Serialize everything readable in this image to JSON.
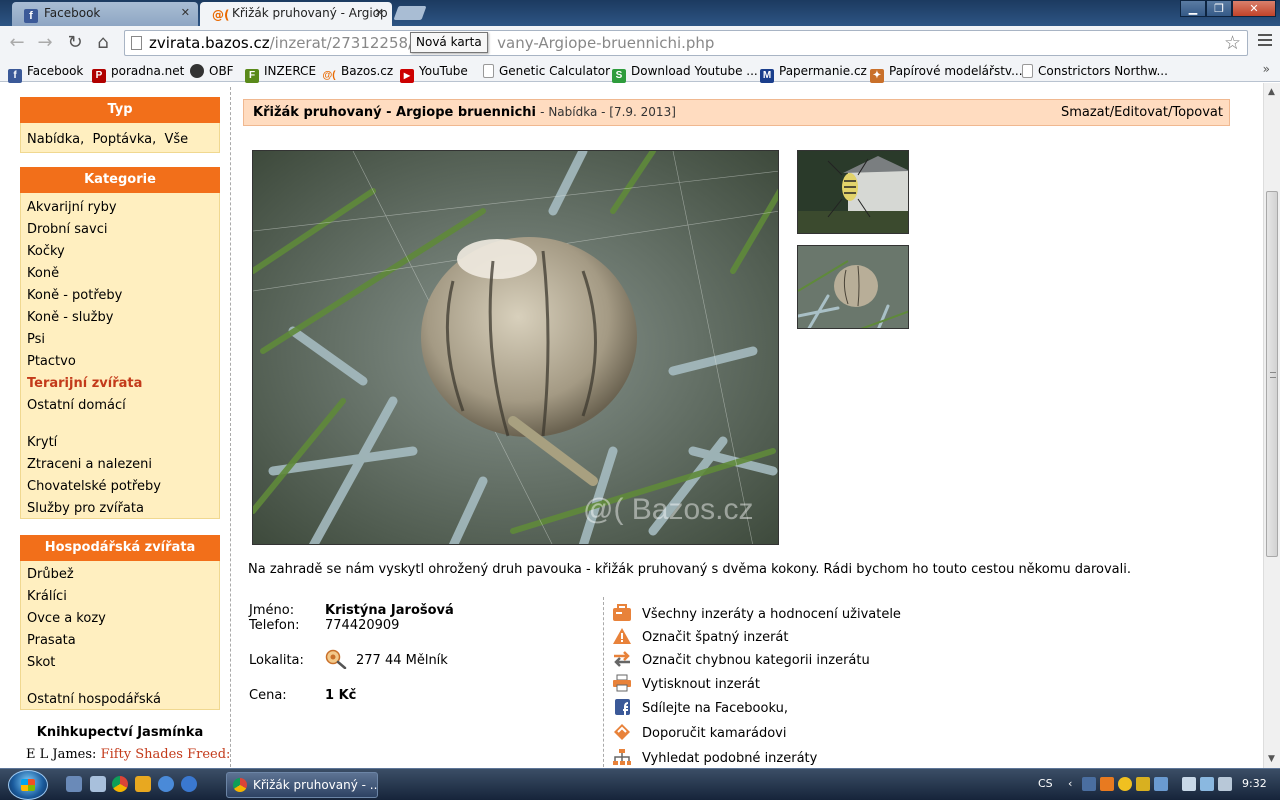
{
  "browser": {
    "tabs": [
      {
        "label": "Facebook",
        "favicon": "facebook-icon",
        "active": false
      },
      {
        "label": "Křižák pruhovaný - Argiop",
        "favicon": "bazos-icon",
        "active": true
      }
    ],
    "window_controls": {
      "minimize": "▁",
      "maximize": "❐",
      "close": "✕"
    },
    "url_host": "zvirata.bazos.cz",
    "url_path_a": "/inzerat/27312258/Kr",
    "url_path_b": "vany-Argiope-bruennichi.php",
    "tooltip": "Nová karta",
    "bookmarks": [
      {
        "label": "Facebook",
        "icon": "facebook-icon",
        "color": "#3b5998",
        "glyph": "f"
      },
      {
        "label": "poradna.net",
        "icon": "poradna-icon",
        "color": "#b00000",
        "glyph": "P"
      },
      {
        "label": "OBF",
        "icon": "obf-icon",
        "color": "#333333",
        "glyph": "●"
      },
      {
        "label": "INZERCE",
        "icon": "inzerce-icon",
        "color": "#5a8a1a",
        "glyph": "F"
      },
      {
        "label": "Bazos.cz",
        "icon": "bazos-icon",
        "color": "#e96900",
        "glyph": "@"
      },
      {
        "label": "YouTube",
        "icon": "youtube-icon",
        "color": "#cc0000",
        "glyph": "▶"
      },
      {
        "label": "Genetic Calculator",
        "icon": "page-icon",
        "color": "#ffffff",
        "glyph": ""
      },
      {
        "label": "Download Youtube ...",
        "icon": "download-youtube-icon",
        "color": "#2e9c3c",
        "glyph": "S"
      },
      {
        "label": "Papermanie.cz",
        "icon": "papermanie-icon",
        "color": "#1a3e8c",
        "glyph": "M"
      },
      {
        "label": "Papírové modelářstv...",
        "icon": "paper-model-icon",
        "color": "#c9702a",
        "glyph": "✦"
      },
      {
        "label": "Constrictors Northw...",
        "icon": "page-icon",
        "color": "#ffffff",
        "glyph": ""
      }
    ],
    "bookmarks_more": "»"
  },
  "sidebar": {
    "typ": {
      "title": "Typ",
      "items": [
        {
          "label": "Nabídka",
          "sep": ","
        },
        {
          "label": "Poptávka",
          "sep": ","
        },
        {
          "label": "Vše",
          "sep": ""
        }
      ]
    },
    "kategorie": {
      "title": "Kategorie",
      "items": [
        "Akvarijní ryby",
        "Drobní savci",
        "Kočky",
        "Koně",
        "Koně - potřeby",
        "Koně - služby",
        "Psi",
        "Ptactvo",
        "Terarijní zvířata",
        "Ostatní domácí",
        "Krytí",
        "Ztraceni a nalezeni",
        "Chovatelské potřeby",
        "Služby pro zvířata"
      ]
    },
    "hospodarska": {
      "title": "Hospodářská zvířata",
      "items": [
        "Drůbež",
        "Králíci",
        "Ovce a kozy",
        "Prasata",
        "Skot",
        "Ostatní hospodářská"
      ]
    },
    "promo": {
      "title": "Knihkupectví Jasmínka",
      "author": "E L James",
      "book": "Fifty Shades Freed:"
    }
  },
  "ad": {
    "title": "Křižák pruhovaný - Argiope bruennichi",
    "meta": "- Nabídka - [7.9. 2013]",
    "actions": "Smazat/Editovat/Topovat",
    "watermark": "@( Bazos.cz",
    "description": "Na zahradě se nám vyskytl ohrožený druh pavouka - křižák pruhovaný s dvěma kokony. Rádi bychom ho touto cestou někomu darovali.",
    "contact": {
      "name_label": "Jméno:",
      "name": "Kristýna Jarošová",
      "phone_label": "Telefon:",
      "phone": "774420909",
      "location_label": "Lokalita:",
      "location": "277 44 Mělník",
      "price_label": "Cena:",
      "price": "1 Kč"
    },
    "links": [
      {
        "label": "Všechny inzeráty a hodnocení uživatele",
        "icon": "user-ads-icon"
      },
      {
        "label": "Označit špatný inzerát",
        "icon": "warning-icon"
      },
      {
        "label": "Označit chybnou kategorii inzerátu",
        "icon": "arrows-icon"
      },
      {
        "label": "Vytisknout inzerát",
        "icon": "printer-icon"
      },
      {
        "label": "Sdílejte na Facebooku,",
        "icon": "facebook-icon"
      },
      {
        "label": "Doporučit kamarádovi",
        "icon": "recommend-icon"
      },
      {
        "label": "Vyhledat podobné inzeráty",
        "icon": "sitemap-icon"
      }
    ]
  },
  "taskbar": {
    "task_label": "Křižák pruhovaný - ...",
    "lang": "CS",
    "clock": "9:32"
  },
  "colors": {
    "accent_orange": "#f26f1a",
    "sidebar_bg": "#ffefc0",
    "ad_header_bg": "#ffdcc0",
    "highlight_red": "#c33a1a"
  }
}
